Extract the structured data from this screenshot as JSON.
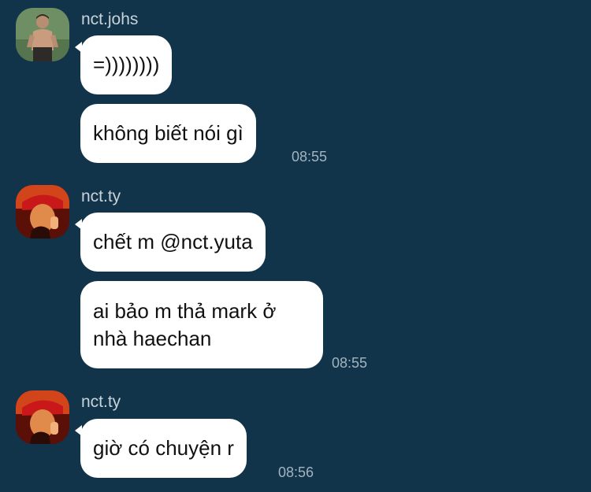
{
  "messages": [
    {
      "sender": "nct.johs",
      "avatar": "avatar-johnny",
      "bubbles": [
        "=))))))))",
        "không biết nói gì"
      ],
      "time": "08:55"
    },
    {
      "sender": "nct.ty",
      "avatar": "avatar-ty",
      "bubbles": [
        "chết m @nct.yuta",
        "ai bảo m thả mark ở nhà haechan"
      ],
      "bubble_lines": [
        "ai bảo m thả mark ở",
        "nhà haechan"
      ],
      "time": "08:55"
    },
    {
      "sender": "nct.ty",
      "avatar": "avatar-ty",
      "bubbles": [
        "giờ có chuyện r"
      ],
      "time": "08:56"
    }
  ],
  "colors": {
    "background": "#11344a",
    "bubble": "#ffffff",
    "sender_name": "#c7d2da",
    "timestamp": "#a3b3bf"
  }
}
